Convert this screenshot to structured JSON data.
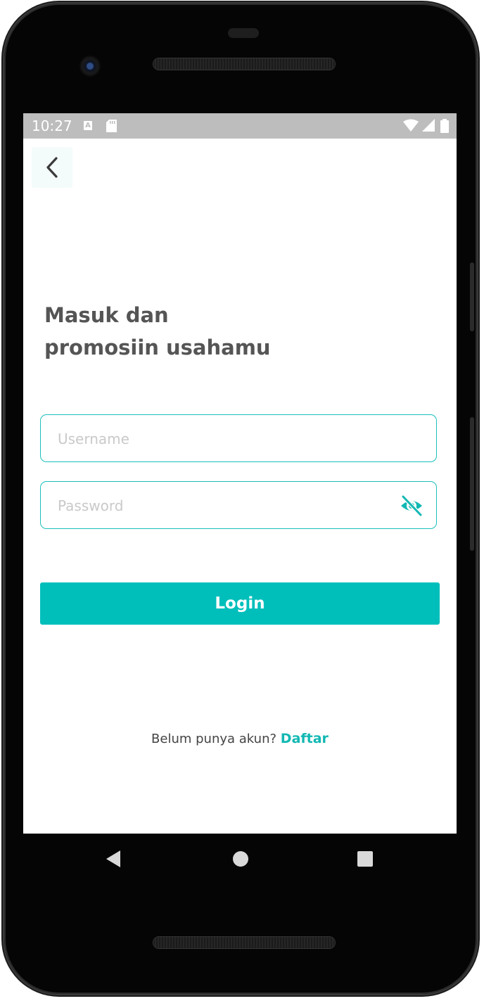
{
  "status_bar": {
    "time": "10:27",
    "notification_icon_letter": "A"
  },
  "header": {
    "back_icon": "chevron-left-icon"
  },
  "headline": {
    "line1": "Masuk dan",
    "line2": "promosiin usahamu"
  },
  "form": {
    "username": {
      "placeholder": "Username",
      "value": ""
    },
    "password": {
      "placeholder": "Password",
      "value": "",
      "toggle_icon": "eye-off-icon"
    },
    "login_label": "Login"
  },
  "signup": {
    "prompt": "Belum punya akun?",
    "link_label": "Daftar"
  },
  "colors": {
    "accent": "#00bfbb",
    "text_dark": "#555555",
    "placeholder": "#c9c9c9",
    "status_bar": "#bdbdbd"
  },
  "nav_bar": {
    "icons": [
      "back-triangle-icon",
      "home-circle-icon",
      "recents-square-icon"
    ]
  }
}
